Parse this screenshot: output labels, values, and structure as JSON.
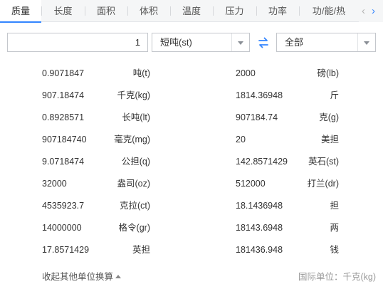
{
  "tabs": [
    {
      "label": "质量",
      "active": true
    },
    {
      "label": "长度",
      "active": false
    },
    {
      "label": "面积",
      "active": false
    },
    {
      "label": "体积",
      "active": false
    },
    {
      "label": "温度",
      "active": false
    },
    {
      "label": "压力",
      "active": false
    },
    {
      "label": "功率",
      "active": false
    },
    {
      "label": "功/能/热",
      "active": false
    }
  ],
  "nav": {
    "prev": "‹",
    "next": "›"
  },
  "converter": {
    "input_value": "1",
    "from_unit": "短吨(st)",
    "to_unit": "全部"
  },
  "results_left": [
    {
      "value": "0.9071847",
      "unit": "吨(t)"
    },
    {
      "value": "907.18474",
      "unit": "千克(kg)"
    },
    {
      "value": "0.8928571",
      "unit": "长吨(lt)"
    },
    {
      "value": "907184740",
      "unit": "毫克(mg)"
    },
    {
      "value": "9.0718474",
      "unit": "公担(q)"
    },
    {
      "value": "32000",
      "unit": "盎司(oz)"
    },
    {
      "value": "4535923.7",
      "unit": "克拉(ct)"
    },
    {
      "value": "14000000",
      "unit": "格令(gr)"
    },
    {
      "value": "17.8571429",
      "unit": "英担"
    }
  ],
  "results_right": [
    {
      "value": "2000",
      "unit": "磅(lb)"
    },
    {
      "value": "1814.36948",
      "unit": "斤"
    },
    {
      "value": "907184.74",
      "unit": "克(g)"
    },
    {
      "value": "20",
      "unit": "美担"
    },
    {
      "value": "142.8571429",
      "unit": "英石(st)"
    },
    {
      "value": "512000",
      "unit": "打兰(dr)"
    },
    {
      "value": "18.1436948",
      "unit": "担"
    },
    {
      "value": "18143.6948",
      "unit": "两"
    },
    {
      "value": "181436.948",
      "unit": "钱"
    }
  ],
  "footer": {
    "collapse_label": "收起其他单位换算",
    "intl_unit": "国际单位：千克(kg)"
  },
  "colors": {
    "accent": "#3385ff"
  }
}
